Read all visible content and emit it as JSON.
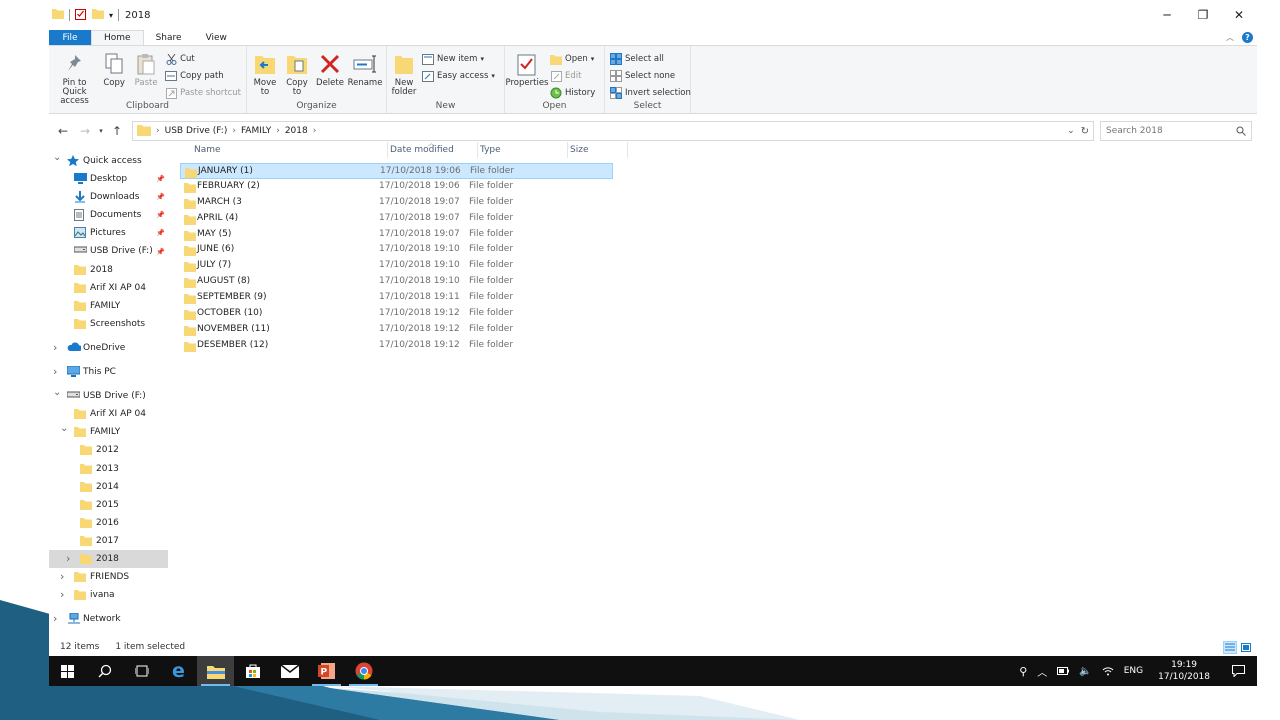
{
  "window": {
    "title": "2018",
    "controls": {
      "minimize": "─",
      "restore": "❐",
      "close": "✕"
    }
  },
  "tabs": {
    "file": "File",
    "home": "Home",
    "share": "Share",
    "view": "View"
  },
  "ribbon": {
    "clipboard": {
      "group": "Clipboard",
      "pin": "Pin to Quick access",
      "copy": "Copy",
      "paste": "Paste",
      "cut": "Cut",
      "copy_path": "Copy path",
      "paste_shortcut": "Paste shortcut"
    },
    "organize": {
      "group": "Organize",
      "move_to": "Move to",
      "copy_to": "Copy to",
      "delete": "Delete",
      "rename": "Rename"
    },
    "new": {
      "group": "New",
      "new_folder": "New folder",
      "new_item": "New item",
      "easy_access": "Easy access"
    },
    "open": {
      "group": "Open",
      "properties": "Properties",
      "open": "Open",
      "edit": "Edit",
      "history": "History"
    },
    "select": {
      "group": "Select",
      "select_all": "Select all",
      "select_none": "Select none",
      "invert": "Invert selection"
    }
  },
  "address": {
    "crumbs": [
      "USB Drive (F:)",
      "FAMILY",
      "2018"
    ],
    "search_placeholder": "Search 2018"
  },
  "columns": {
    "name": "Name",
    "date": "Date modified",
    "type": "Type",
    "size": "Size"
  },
  "files": [
    {
      "name": "JANUARY (1)",
      "date": "17/10/2018 19:06",
      "type": "File folder"
    },
    {
      "name": "FEBRUARY (2)",
      "date": "17/10/2018 19:06",
      "type": "File folder"
    },
    {
      "name": "MARCH (3",
      "date": "17/10/2018 19:07",
      "type": "File folder"
    },
    {
      "name": "APRIL (4)",
      "date": "17/10/2018 19:07",
      "type": "File folder"
    },
    {
      "name": "MAY (5)",
      "date": "17/10/2018 19:07",
      "type": "File folder"
    },
    {
      "name": "JUNE (6)",
      "date": "17/10/2018 19:10",
      "type": "File folder"
    },
    {
      "name": "JULY (7)",
      "date": "17/10/2018 19:10",
      "type": "File folder"
    },
    {
      "name": "AUGUST (8)",
      "date": "17/10/2018 19:10",
      "type": "File folder"
    },
    {
      "name": "SEPTEMBER (9)",
      "date": "17/10/2018 19:11",
      "type": "File folder"
    },
    {
      "name": "OCTOBER (10)",
      "date": "17/10/2018 19:12",
      "type": "File folder"
    },
    {
      "name": "NOVEMBER (11)",
      "date": "17/10/2018 19:12",
      "type": "File folder"
    },
    {
      "name": "DESEMBER (12)",
      "date": "17/10/2018 19:12",
      "type": "File folder"
    }
  ],
  "nav": {
    "quick_access": "Quick access",
    "quick_items": [
      {
        "label": "Desktop",
        "icon": "desktop-icon",
        "pinned": true
      },
      {
        "label": "Downloads",
        "icon": "downloads-icon",
        "pinned": true
      },
      {
        "label": "Documents",
        "icon": "documents-icon",
        "pinned": true
      },
      {
        "label": "Pictures",
        "icon": "pictures-icon",
        "pinned": true
      },
      {
        "label": "USB Drive (F:)",
        "icon": "usb-drive-icon",
        "pinned": true
      },
      {
        "label": "2018",
        "icon": "folder-icon",
        "pinned": false
      },
      {
        "label": "Arif XI AP 04",
        "icon": "folder-icon",
        "pinned": false
      },
      {
        "label": "FAMILY",
        "icon": "folder-icon",
        "pinned": false
      },
      {
        "label": "Screenshots",
        "icon": "folder-icon",
        "pinned": false
      }
    ],
    "onedrive": "OneDrive",
    "this_pc": "This PC",
    "usb": "USB Drive (F:)",
    "usb_children": [
      "Arif XI AP 04",
      "FAMILY"
    ],
    "family_children": [
      "2012",
      "2013",
      "2014",
      "2015",
      "2016",
      "2017",
      "2018"
    ],
    "usb_more": [
      "FRIENDS",
      "ivana"
    ],
    "network": "Network"
  },
  "status": {
    "count": "12 items",
    "selected": "1 item selected"
  },
  "tray": {
    "lang": "ENG",
    "time": "19:19",
    "date": "17/10/2018"
  },
  "colors": {
    "accent": "#1979ca",
    "selection": "#cce8ff",
    "folder": "#f8d775",
    "taskbar": "#101010"
  }
}
